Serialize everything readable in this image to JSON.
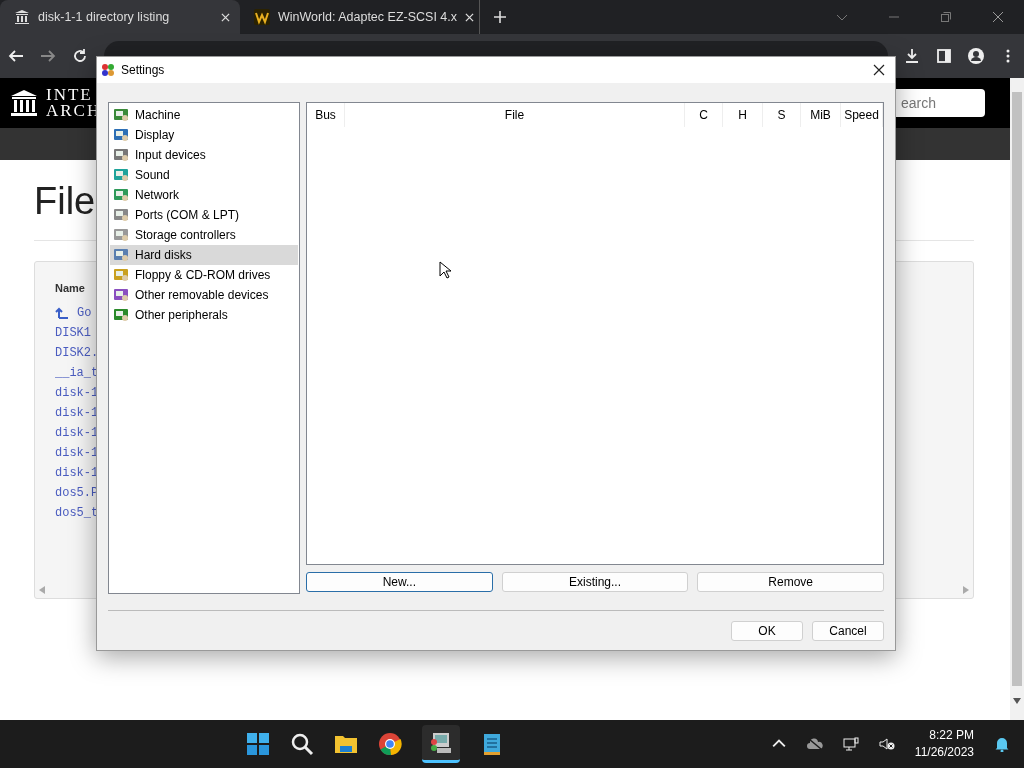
{
  "browser": {
    "tabs": [
      {
        "title": "disk-1-1 directory listing",
        "selected": true
      },
      {
        "title": "WinWorld: Adaptec EZ-SCSI 4.x",
        "selected": false
      }
    ]
  },
  "page": {
    "logo_lines": [
      "INTE",
      "ARCH"
    ],
    "search_placeholder": "earch",
    "heading": "File",
    "name_header": "Name",
    "rows": [
      {
        "kind": "parent",
        "text": "Go"
      },
      {
        "kind": "file",
        "text": "DISK1"
      },
      {
        "kind": "file",
        "text": "DISK2."
      },
      {
        "kind": "file",
        "text": "__ia_t"
      },
      {
        "kind": "file",
        "text": "disk-1"
      },
      {
        "kind": "file",
        "text": "disk-1"
      },
      {
        "kind": "file",
        "text": "disk-1"
      },
      {
        "kind": "file",
        "text": "disk-1"
      },
      {
        "kind": "file",
        "text": "disk-1"
      },
      {
        "kind": "file",
        "text": "dos5.P"
      },
      {
        "kind": "file",
        "text": "dos5_t"
      }
    ]
  },
  "dialog": {
    "title": "Settings",
    "categories": [
      {
        "label": "Machine",
        "selected": false
      },
      {
        "label": "Display",
        "selected": false
      },
      {
        "label": "Input devices",
        "selected": false
      },
      {
        "label": "Sound",
        "selected": false
      },
      {
        "label": "Network",
        "selected": false
      },
      {
        "label": "Ports (COM & LPT)",
        "selected": false
      },
      {
        "label": "Storage controllers",
        "selected": false
      },
      {
        "label": "Hard disks",
        "selected": true
      },
      {
        "label": "Floppy & CD-ROM drives",
        "selected": false
      },
      {
        "label": "Other removable devices",
        "selected": false
      },
      {
        "label": "Other peripherals",
        "selected": false
      }
    ],
    "columns": [
      "Bus",
      "File",
      "C",
      "H",
      "S",
      "MiB",
      "Speed"
    ],
    "buttons": [
      {
        "label": "New...",
        "focused": true
      },
      {
        "label": "Existing...",
        "focused": false
      },
      {
        "label": "Remove",
        "focused": false
      }
    ],
    "footer_buttons": [
      "OK",
      "Cancel"
    ]
  },
  "taskbar": {
    "time": "8:22 PM",
    "date": "11/26/2023"
  }
}
